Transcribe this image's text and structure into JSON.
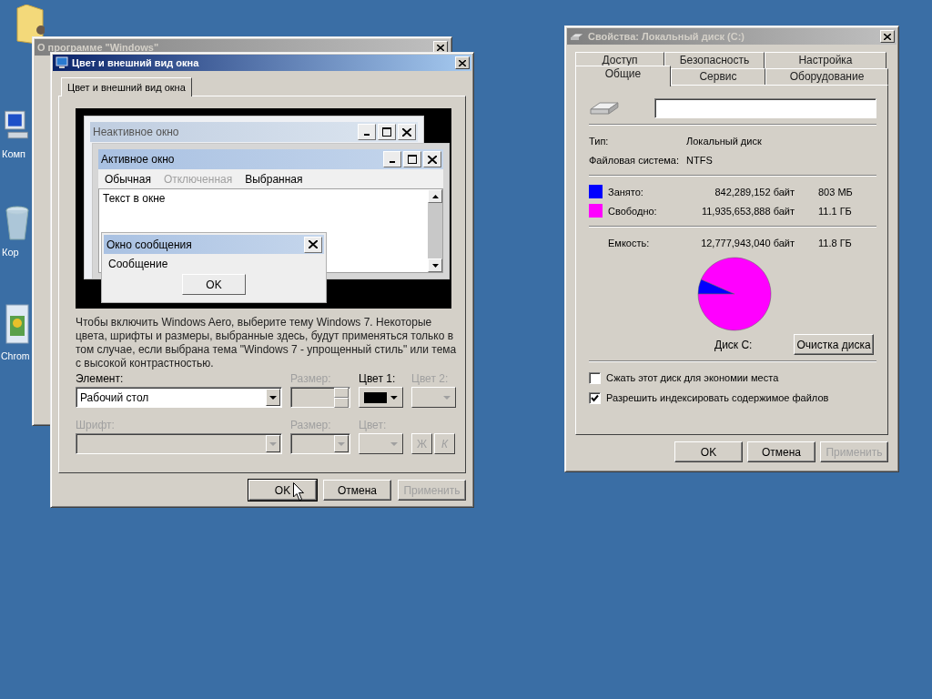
{
  "desktop": {
    "icons": [
      {
        "kind": "folder"
      },
      {
        "kind": "computer",
        "label": "Комп"
      },
      {
        "kind": "bin",
        "label": "Кор"
      },
      {
        "kind": "installer",
        "label": "Chrom"
      }
    ]
  },
  "about_window": {
    "title": "О программе \"Windows\""
  },
  "appearance_window": {
    "title": "Цвет и внешний вид окна",
    "tabs": [
      {
        "label": "Цвет и внешний вид окна",
        "selected": true
      }
    ],
    "preview": {
      "inactive_window": {
        "title": "Неактивное окно"
      },
      "active_window": {
        "title": "Активное окно",
        "menu": [
          {
            "label": "Обычная",
            "disabled": false
          },
          {
            "label": "Отключенная",
            "disabled": true
          },
          {
            "label": "Выбранная",
            "disabled": false
          }
        ],
        "text": "Текст в окне"
      },
      "message_box": {
        "title": "Окно сообщения",
        "text": "Сообщение",
        "button": "OK"
      }
    },
    "description": "Чтобы включить Windows Aero, выберите тему Windows 7. Некоторые цвета, шрифты и размеры, выбранные здесь, будут применяться только в том случае, если выбрана тема \"Windows 7 - упрощенный стиль\" или тема с высокой контрастностью.",
    "element": {
      "label": "Элемент:",
      "value": "Рабочий стол"
    },
    "size": {
      "label": "Размер:",
      "disabled": true
    },
    "color1": {
      "label": "Цвет 1:",
      "disabled": false,
      "color": "#000000"
    },
    "color2": {
      "label": "Цвет 2:",
      "disabled": true
    },
    "font": {
      "label": "Шрифт:",
      "disabled": true
    },
    "font_size": {
      "label": "Размер:",
      "disabled": true
    },
    "font_color": {
      "label": "Цвет:",
      "disabled": true
    },
    "bold": {
      "label": "Ж",
      "disabled": true
    },
    "italic": {
      "label": "К",
      "disabled": true
    },
    "buttons": [
      {
        "label": "OK",
        "disabled": false,
        "default": true
      },
      {
        "label": "Отмена",
        "disabled": false,
        "default": false
      },
      {
        "label": "Применить",
        "disabled": true,
        "default": false
      }
    ]
  },
  "properties_window": {
    "title": "Свойства: Локальный диск (C:)",
    "tab_rows": [
      [
        {
          "label": "Доступ",
          "selected": false
        },
        {
          "label": "Безопасность",
          "selected": false
        },
        {
          "label": "Настройка",
          "selected": false
        }
      ],
      [
        {
          "label": "Общие",
          "selected": true
        },
        {
          "label": "Сервис",
          "selected": false
        },
        {
          "label": "Оборудование",
          "selected": false
        }
      ]
    ],
    "info": [
      {
        "label": "Тип:",
        "value": "Локальный диск"
      },
      {
        "label": "Файловая система:",
        "value": "NTFS"
      }
    ],
    "usage": [
      {
        "label": "Занято:",
        "color": "#0000ff",
        "bytes": "842,289,152 байт",
        "size": "803 МБ"
      },
      {
        "label": "Свободно:",
        "color": "#ff00ff",
        "bytes": "11,935,653,888 байт",
        "size": "11.1 ГБ"
      }
    ],
    "capacity": {
      "label": "Емкость:",
      "bytes": "12,777,943,040 байт",
      "size": "11.8 ГБ"
    },
    "chart_data": {
      "type": "pie",
      "values": [
        6.59,
        93.41
      ]
    },
    "disk_label": "Диск C:",
    "cleanup_button": "Очистка диска",
    "checkboxes": [
      {
        "label": "Сжать этот диск для экономии места",
        "checked": false
      },
      {
        "label": "Разрешить индексировать содержимое файлов",
        "checked": true
      }
    ],
    "buttons": [
      {
        "label": "OK",
        "disabled": false
      },
      {
        "label": "Отмена",
        "disabled": false
      },
      {
        "label": "Применить",
        "disabled": true
      }
    ]
  }
}
